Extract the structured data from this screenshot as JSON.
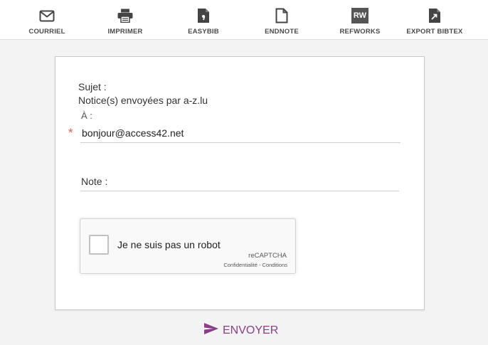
{
  "toolbar": {
    "items": [
      {
        "label": "COURRIEL",
        "icon": "envelope-icon"
      },
      {
        "label": "IMPRIMER",
        "icon": "printer-icon"
      },
      {
        "label": "EASYBIB",
        "icon": "easybib-icon"
      },
      {
        "label": "ENDNOTE",
        "icon": "document-icon"
      },
      {
        "label": "REFWORKS",
        "icon": "refworks-icon",
        "badge": "RW"
      },
      {
        "label": "EXPORT BIBTEX",
        "icon": "export-document-icon"
      }
    ]
  },
  "form": {
    "subject_label": "Sujet :",
    "subject_value": "Notice(s) envoyées par a-z.lu",
    "to_label": "À :",
    "required_mark": "*",
    "to_value": "bonjour@access42.net",
    "note_label": "Note :"
  },
  "captcha": {
    "label": "Je ne suis pas un robot",
    "brand": "reCAPTCHA",
    "privacy": "Confidentialité",
    "separator": " - ",
    "terms": "Conditions"
  },
  "send": {
    "label": "ENVOYER",
    "color": "#8b3d8a"
  }
}
